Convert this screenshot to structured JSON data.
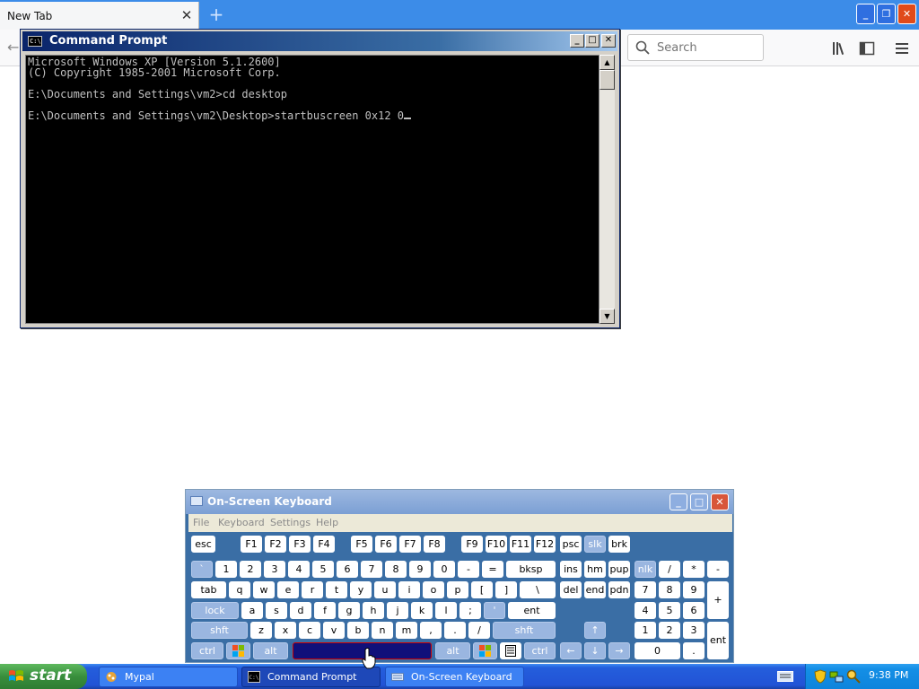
{
  "browser": {
    "tab_title": "New Tab",
    "tab_close": "✕",
    "new_tab": "+",
    "search_placeholder": "Search",
    "window_buttons": {
      "minimize": "_",
      "restore": "❐",
      "close": "✕"
    }
  },
  "cmd": {
    "title": "Command Prompt",
    "icon_text": "C:\\",
    "buttons": {
      "minimize": "_",
      "maximize": "□",
      "close": "✕"
    },
    "lines": [
      "Microsoft Windows XP [Version 5.1.2600]",
      "(C) Copyright 1985-2001 Microsoft Corp.",
      "",
      "E:\\Documents and Settings\\vm2>cd desktop",
      "",
      "E:\\Documents and Settings\\vm2\\Desktop>startbuscreen 0x12 0"
    ]
  },
  "osk": {
    "title": "On-Screen Keyboard",
    "menu": [
      "File",
      "Keyboard",
      "Settings",
      "Help"
    ],
    "buttons": {
      "minimize": "_",
      "maximize": "□",
      "close": "✕"
    },
    "keys": {
      "esc": "esc",
      "f1": "F1",
      "f2": "F2",
      "f3": "F3",
      "f4": "F4",
      "f5": "F5",
      "f6": "F6",
      "f7": "F7",
      "f8": "F8",
      "f9": "F9",
      "f10": "F10",
      "f11": "F11",
      "f12": "F12",
      "psc": "psc",
      "slk": "slk",
      "brk": "brk",
      "backtick": "`",
      "n1": "1",
      "n2": "2",
      "n3": "3",
      "n4": "4",
      "n5": "5",
      "n6": "6",
      "n7": "7",
      "n8": "8",
      "n9": "9",
      "n0": "0",
      "minus": "-",
      "equals": "=",
      "bksp": "bksp",
      "ins": "ins",
      "hm": "hm",
      "pup": "pup",
      "nlk": "nlk",
      "slash": "/",
      "star": "*",
      "npminus": "-",
      "tab": "tab",
      "q": "q",
      "w": "w",
      "e": "e",
      "r": "r",
      "t": "t",
      "y": "y",
      "u": "u",
      "i": "i",
      "o": "o",
      "p": "p",
      "lbracket": "[",
      "rbracket": "]",
      "backslash": "\\",
      "del": "del",
      "end": "end",
      "pdn": "pdn",
      "np7": "7",
      "np8": "8",
      "np9": "9",
      "plus": "+",
      "lock": "lock",
      "a": "a",
      "s": "s",
      "d": "d",
      "f": "f",
      "g": "g",
      "h": "h",
      "j": "j",
      "k": "k",
      "l": "l",
      "semicolon": ";",
      "quote": "'",
      "ent": "ent",
      "np4": "4",
      "np5": "5",
      "np6": "6",
      "lshft": "shft",
      "z": "z",
      "x": "x",
      "c": "c",
      "v": "v",
      "b": "b",
      "n": "n",
      "m": "m",
      "comma": ",",
      "period": ".",
      "fslash": "/",
      "rshft": "shft",
      "up": "↑",
      "np1": "1",
      "np2": "2",
      "np3": "3",
      "npent": "ent",
      "lctrl": "ctrl",
      "lalt": "alt",
      "ralt": "alt",
      "rctrl": "ctrl",
      "left": "←",
      "down": "↓",
      "right": "→",
      "np0": "0",
      "npdot": "."
    }
  },
  "taskbar": {
    "start": "start",
    "items": [
      {
        "label": "Mypal",
        "active": false
      },
      {
        "label": "Command Prompt",
        "active": true
      },
      {
        "label": "On-Screen Keyboard",
        "active": false
      }
    ],
    "clock": "9:38 PM"
  },
  "colors": {
    "xp_blue": "#245edc",
    "start_green": "#388e3c",
    "cmd_text": "#c0c0c0",
    "osk_space_selected": "#10107a"
  },
  "icons": [
    "search-icon",
    "library-icon",
    "sidebar-icon",
    "menu-icon",
    "windows-flag-icon",
    "context-menu-icon"
  ]
}
